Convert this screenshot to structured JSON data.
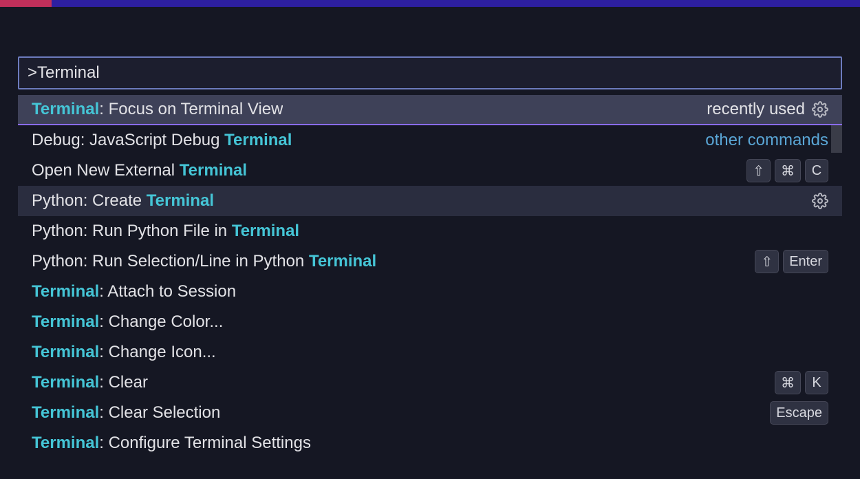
{
  "search": {
    "value": ">Terminal"
  },
  "labels": {
    "recently_used": "recently used",
    "other_commands": "other commands"
  },
  "rows": {
    "r0": {
      "pre": "",
      "hl": "Terminal",
      "post": ": Focus on Terminal View"
    },
    "r1": {
      "pre": "Debug: JavaScript Debug ",
      "hl": "Terminal",
      "post": ""
    },
    "r2": {
      "pre": "Open New External ",
      "hl": "Terminal",
      "post": ""
    },
    "r3": {
      "pre": "Python: Create ",
      "hl": "Terminal",
      "post": ""
    },
    "r4": {
      "pre": "Python: Run Python File in ",
      "hl": "Terminal",
      "post": ""
    },
    "r5": {
      "pre": "Python: Run Selection/Line in Python ",
      "hl": "Terminal",
      "post": ""
    },
    "r6": {
      "pre": "",
      "hl": "Terminal",
      "post": ": Attach to Session"
    },
    "r7": {
      "pre": "",
      "hl": "Terminal",
      "post": ": Change Color..."
    },
    "r8": {
      "pre": "",
      "hl": "Terminal",
      "post": ": Change Icon..."
    },
    "r9": {
      "pre": "",
      "hl": "Terminal",
      "post": ": Clear"
    },
    "r10": {
      "pre": "",
      "hl": "Terminal",
      "post": ": Clear Selection"
    },
    "r11": {
      "pre": "",
      "hl": "Terminal",
      "post": ": Configure Terminal Settings"
    }
  },
  "keybindings": {
    "r2": [
      "⇧",
      "⌘",
      "C"
    ],
    "r5": [
      "⇧",
      "Enter"
    ],
    "r9": [
      "⌘",
      "K"
    ],
    "r10": [
      "Escape"
    ]
  }
}
